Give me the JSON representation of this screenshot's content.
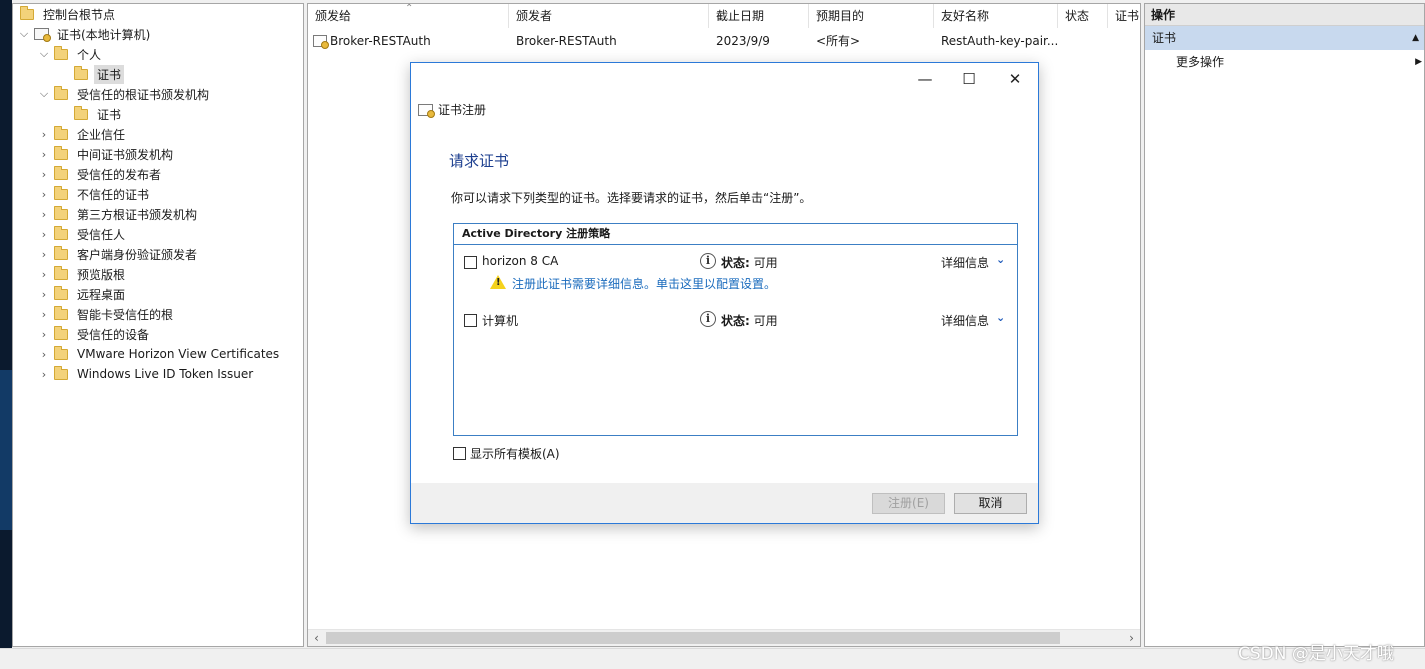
{
  "tree": {
    "root_label": "控制台根节点",
    "store_label": "证书(本地计算机)",
    "items": [
      {
        "label": "个人",
        "expanded": true
      },
      {
        "label": "证书",
        "selected": true
      },
      {
        "label": "受信任的根证书颁发机构",
        "expanded": true
      },
      {
        "label": "证书"
      },
      {
        "label": "企业信任"
      },
      {
        "label": "中间证书颁发机构"
      },
      {
        "label": "受信任的发布者"
      },
      {
        "label": "不信任的证书"
      },
      {
        "label": "第三方根证书颁发机构"
      },
      {
        "label": "受信任人"
      },
      {
        "label": "客户端身份验证颁发者"
      },
      {
        "label": "预览版根"
      },
      {
        "label": "远程桌面"
      },
      {
        "label": "智能卡受信任的根"
      },
      {
        "label": "受信任的设备"
      },
      {
        "label": "VMware Horizon View Certificates"
      },
      {
        "label": "Windows Live ID Token Issuer"
      }
    ]
  },
  "list": {
    "columns": [
      "颁发给",
      "颁发者",
      "截止日期",
      "预期目的",
      "友好名称",
      "状态",
      "证书"
    ],
    "rows": [
      {
        "issued_to": "Broker-RESTAuth",
        "issued_by": "Broker-RESTAuth",
        "expiry": "2023/9/9",
        "purpose": "<所有>",
        "friendly_name": "RestAuth-key-pair...",
        "status": "",
        "template": ""
      }
    ]
  },
  "actions": {
    "header": "操作",
    "section": "证书",
    "more": "更多操作"
  },
  "dialog": {
    "title": "证书注册",
    "heading": "请求证书",
    "description": "你可以请求下列类型的证书。选择要请求的证书，然后单击“注册”。",
    "policy_title": "Active Directory 注册策略",
    "templates": [
      {
        "name": "horizon 8 CA",
        "status_label": "状态:",
        "status_value": "可用",
        "details": "详细信息"
      },
      {
        "name": "计算机",
        "status_label": "状态:",
        "status_value": "可用",
        "details": "详细信息"
      }
    ],
    "warning": "注册此证书需要详细信息。单击这里以配置设置。",
    "show_all": "显示所有模板(A)",
    "enroll_btn": "注册(E)",
    "cancel_btn": "取消",
    "ctrl_min": "—",
    "ctrl_max": "☐",
    "ctrl_close": "✕"
  },
  "watermark": "CSDN @是小天才哦"
}
